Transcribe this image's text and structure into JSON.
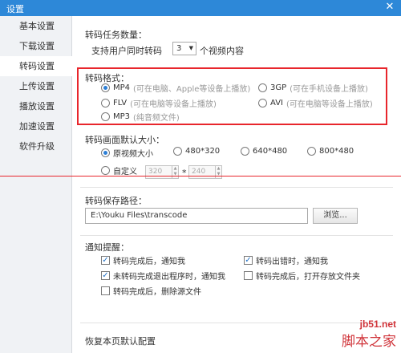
{
  "window": {
    "title": "设置",
    "close_glyph": "✕"
  },
  "sidebar": {
    "items": [
      {
        "label": "基本设置"
      },
      {
        "label": "下载设置"
      },
      {
        "label": "转码设置"
      },
      {
        "label": "上传设置"
      },
      {
        "label": "播放设置"
      },
      {
        "label": "加速设置"
      },
      {
        "label": "软件升级"
      }
    ],
    "active_index": 2
  },
  "tasks": {
    "heading": "转码任务数量：",
    "prefix": "支持用户同时转码",
    "value": "3",
    "suffix": "个视频内容"
  },
  "format": {
    "heading": "转码格式：",
    "options": [
      {
        "name": "MP4",
        "hint": "(可在电脑、Apple等设备上播放)",
        "selected": true
      },
      {
        "name": "3GP",
        "hint": "(可在手机设备上播放)",
        "selected": false
      },
      {
        "name": "FLV",
        "hint": "(可在电脑等设备上播放)",
        "selected": false
      },
      {
        "name": "AVI",
        "hint": "(可在电脑等设备上播放)",
        "selected": false
      },
      {
        "name": "MP3",
        "hint": "(纯音频文件)",
        "selected": false
      }
    ]
  },
  "size": {
    "heading": "转码画面默认大小：",
    "options": [
      {
        "label": "原视频大小",
        "selected": true
      },
      {
        "label": "480*320",
        "selected": false
      },
      {
        "label": "640*480",
        "selected": false
      },
      {
        "label": "800*480",
        "selected": false
      }
    ],
    "custom": {
      "label": "自定义",
      "width": "320",
      "height": "240",
      "separator": "*"
    }
  },
  "path": {
    "heading": "转码保存路径：",
    "value": "E:\\Youku Files\\transcode",
    "browse_label": "浏览..."
  },
  "notify": {
    "heading": "通知提醒：",
    "options": [
      {
        "label": "转码完成后，通知我",
        "checked": true
      },
      {
        "label": "转码出错时，通知我",
        "checked": true
      },
      {
        "label": "未转码完成退出程序时，通知我",
        "checked": true
      },
      {
        "label": "转码完成后，打开存放文件夹",
        "checked": false
      },
      {
        "label": "转码完成后，删除源文件",
        "checked": false
      }
    ]
  },
  "footer": {
    "restore_label": "恢复本页默认配置"
  },
  "watermark": {
    "line1": "jb51.net",
    "line2": "脚本之家"
  },
  "colors": {
    "titlebar": "#2d88d8",
    "highlight": "#e8262c",
    "accent": "#2d7fd6"
  }
}
